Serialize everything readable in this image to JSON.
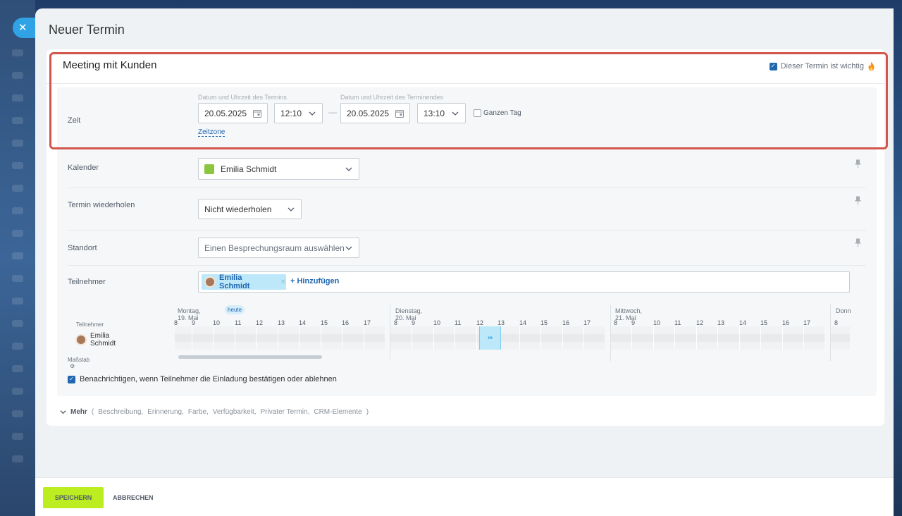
{
  "window": {
    "title": "Neuer Termin"
  },
  "colors": {
    "accent": "#2fa3e6",
    "link": "#2067b0",
    "save": "#bbed21",
    "highlight": "#d3554b",
    "calendar": "#8cc63f"
  },
  "event": {
    "name": "Meeting mit Kunden",
    "important_label": "Dieser Termin ist wichtig",
    "important_checked": true
  },
  "time": {
    "label": "Zeit",
    "start_caption": "Datum und Uhrzeit des Termins",
    "end_caption": "Datum und Uhrzeit des Terminendes",
    "start_date": "20.05.2025",
    "start_time": "12:10",
    "end_date": "20.05.2025",
    "end_time": "13:10",
    "separator": "—",
    "allday_label": "Ganzen Tag",
    "timezone_link": "Zeitzone"
  },
  "calendar": {
    "label": "Kalender",
    "value": "Emilia Schmidt"
  },
  "repeat": {
    "label": "Termin wiederholen",
    "value": "Nicht wiederholen"
  },
  "location": {
    "label": "Standort",
    "placeholder": "Einen Besprechungsraum auswählen"
  },
  "attendees": {
    "label": "Teilnehmer",
    "chips": [
      "Emilia Schmidt"
    ],
    "add_label": "+ Hinzufügen"
  },
  "planner": {
    "row_header": "Teilnehmer",
    "days": [
      {
        "label": "Montag, 19. Mai",
        "today": "heute",
        "hours": [
          "8",
          "9",
          "10",
          "11",
          "12",
          "13",
          "14",
          "15",
          "16",
          "17"
        ]
      },
      {
        "label": "Dienstag, 20. Mai",
        "hours": [
          "8",
          "9",
          "10",
          "11",
          "12",
          "13",
          "14",
          "15",
          "16",
          "17"
        ]
      },
      {
        "label": "Mittwoch, 21. Mai",
        "hours": [
          "8",
          "9",
          "10",
          "11",
          "12",
          "13",
          "14",
          "15",
          "16",
          "17"
        ]
      },
      {
        "label": "Donn",
        "hours": [
          "8"
        ]
      }
    ],
    "person": "Emilia Schmidt",
    "scale_label": "Maßstab"
  },
  "notify": {
    "label": "Benachrichtigen, wenn Teilnehmer die Einladung bestätigen oder ablehnen",
    "checked": true
  },
  "more": {
    "label": "Mehr",
    "open": "(",
    "close": ")",
    "items": [
      "Beschreibung,",
      "Erinnerung,",
      "Farbe,",
      "Verfügbarkeit,",
      "Privater Termin,",
      "CRM-Elemente"
    ]
  },
  "footer": {
    "save": "SPEICHERN",
    "cancel": "ABBRECHEN"
  }
}
